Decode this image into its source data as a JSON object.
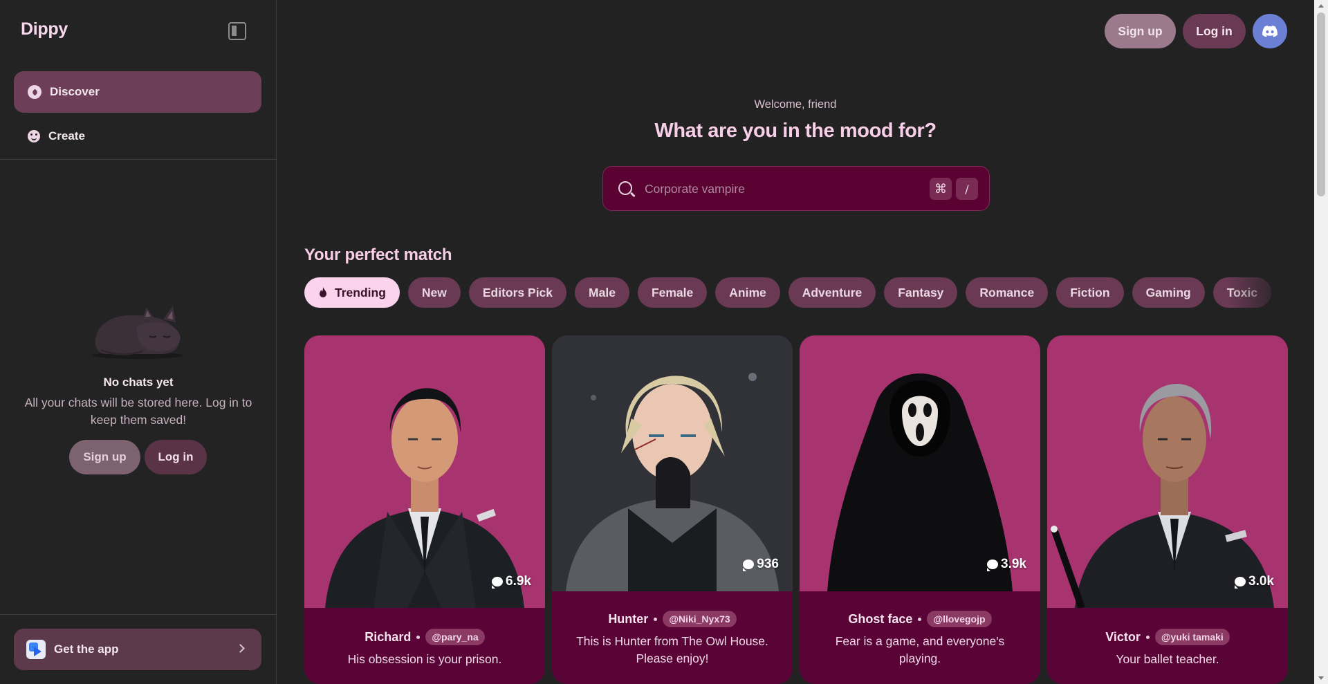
{
  "app": {
    "name": "Dippy"
  },
  "sidebar": {
    "nav": [
      {
        "label": "Discover",
        "icon": "compass-icon",
        "active": true
      },
      {
        "label": "Create",
        "icon": "smiley-icon",
        "active": false
      }
    ],
    "empty_state": {
      "title": "No chats yet",
      "description": "All your chats will be stored here. Log in to keep them saved!",
      "signup_label": "Sign up",
      "login_label": "Log in"
    },
    "get_app_label": "Get the app"
  },
  "header": {
    "signup_label": "Sign up",
    "login_label": "Log in",
    "discord_icon": "discord-icon"
  },
  "hero": {
    "welcome": "Welcome, friend",
    "headline": "What are you in the mood for?",
    "search_placeholder": "Corporate vampire",
    "shortcut_keys": [
      "⌘",
      "/"
    ]
  },
  "section": {
    "title": "Your perfect match",
    "chips": [
      "Trending",
      "New",
      "Editors Pick",
      "Male",
      "Female",
      "Anime",
      "Adventure",
      "Fantasy",
      "Romance",
      "Fiction",
      "Gaming",
      "Toxic"
    ]
  },
  "cards": [
    {
      "name": "Richard",
      "handle": "@pary_na",
      "description": "His obsession is your prison.",
      "chats": "6.9k"
    },
    {
      "name": "Hunter",
      "handle": "@Niki_Nyx73",
      "description": "This is Hunter from The Owl House. Please enjoy!",
      "chats": "936"
    },
    {
      "name": "Ghost face",
      "handle": "@llovegojp",
      "description": "Fear is a game, and everyone's playing.",
      "chats": "3.9k"
    },
    {
      "name": "Victor",
      "handle": "@yuki tamaki",
      "description": "Your ballet teacher.",
      "chats": "3.0k"
    }
  ],
  "colors": {
    "background": "#232223",
    "accent": "#6a3a55",
    "card_footer": "#590337",
    "headline": "#f8cfe8",
    "discord": "#6b7fd4"
  }
}
